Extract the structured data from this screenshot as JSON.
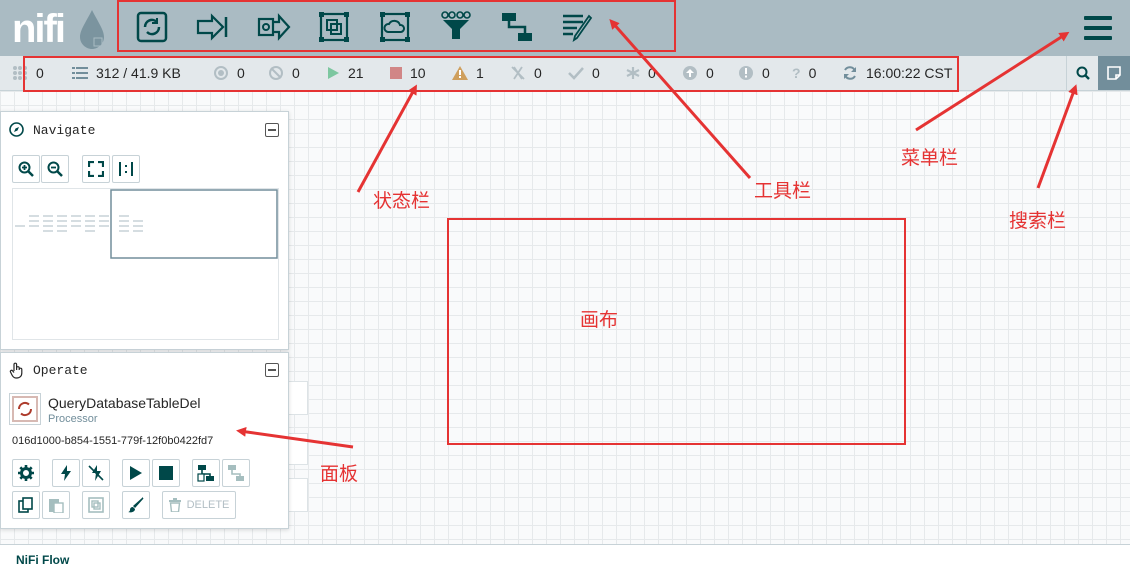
{
  "toolbar": {
    "items": [
      "processor-icon",
      "input-port-icon",
      "output-port-icon",
      "process-group-icon",
      "remote-process-group-icon",
      "funnel-icon",
      "template-icon",
      "label-icon"
    ]
  },
  "status": {
    "cluster": "0",
    "queued": "312 / 41.9 KB",
    "transmitting": "0",
    "not_transmitting": "0",
    "running": "21",
    "stopped": "10",
    "invalid": "1",
    "disabled": "0",
    "up_to_date": "0",
    "locally_modified": "0",
    "stale": "0",
    "locally_modified_stale": "0",
    "sync_failure": "0",
    "last_refreshed": "16:00:22 CST"
  },
  "navigate": {
    "title": "Navigate"
  },
  "operate": {
    "title": "Operate",
    "component_name": "QueryDatabaseTableDel",
    "component_type": "Processor",
    "component_id": "016d1000-b854-1551-779f-12f0b0422fd7",
    "delete_label": "DELETE"
  },
  "footer": {
    "breadcrumb": "NiFi Flow"
  },
  "annotations": {
    "status_bar": "状态栏",
    "toolbar": "工具栏",
    "menu_bar": "菜单栏",
    "search_bar": "搜索栏",
    "canvas": "画布",
    "panel": "面板"
  },
  "colors": {
    "accent": "#004849",
    "topbar": "#aabbc3",
    "annotation": "#e53333"
  }
}
